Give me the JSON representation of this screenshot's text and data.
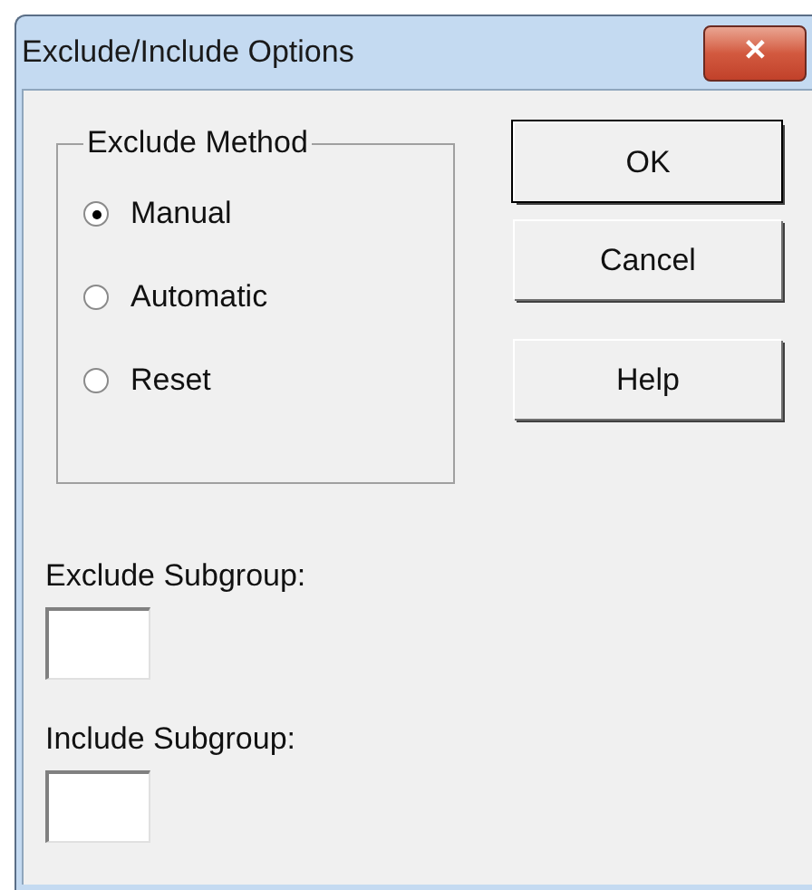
{
  "window": {
    "title": "Exclude/Include Options",
    "close_label": "✕"
  },
  "exclude_method": {
    "label": "Exclude Method",
    "options": [
      {
        "label": "Manual",
        "selected": true
      },
      {
        "label": "Automatic",
        "selected": false
      },
      {
        "label": "Reset",
        "selected": false
      }
    ]
  },
  "buttons": [
    {
      "label": "OK",
      "default": true
    },
    {
      "label": "Cancel",
      "default": false
    },
    {
      "label": "Help",
      "default": false
    }
  ],
  "fields": [
    {
      "label": "Exclude Subgroup:"
    },
    {
      "label": "Include Subgroup:"
    }
  ]
}
